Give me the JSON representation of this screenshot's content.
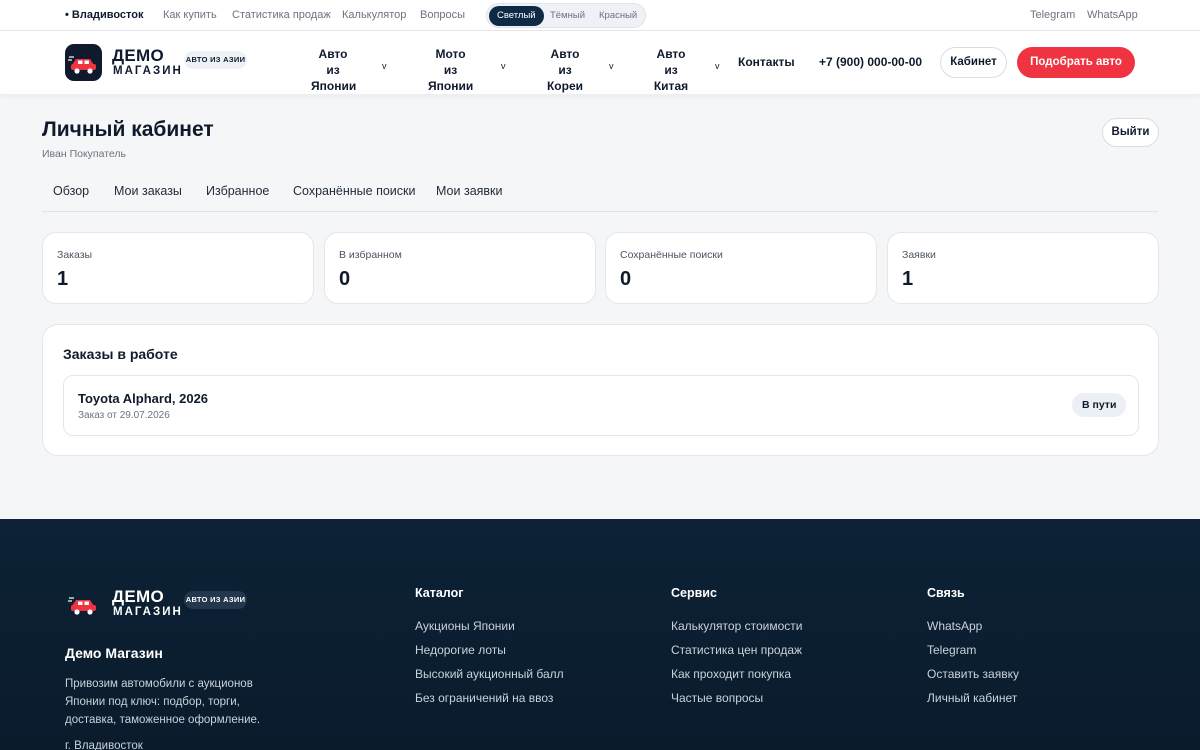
{
  "topbar": {
    "city": "• Владивосток",
    "links": [
      "Как купить",
      "Статистика продаж",
      "Калькулятор",
      "Вопросы"
    ],
    "themes": [
      "Светлый",
      "Тёмный",
      "Красный"
    ],
    "active_theme": "Светлый",
    "socials": [
      "Telegram",
      "WhatsApp"
    ]
  },
  "header": {
    "logo_line1": "ДЕМО",
    "logo_line2": "МАГАЗИН",
    "logo_badge": "АВТО ИЗ АЗИИ",
    "nav": [
      {
        "line1": "Авто из",
        "line2": "Японии"
      },
      {
        "line1": "Мото из",
        "line2": "Японии"
      },
      {
        "line1": "Авто из",
        "line2": "Кореи"
      },
      {
        "line1": "Авто из",
        "line2": "Китая"
      }
    ],
    "nav_chevron": "v",
    "contacts": "Контакты",
    "phone": "+7 (900) 000-00-00",
    "cabinet_button": "Кабинет",
    "pick_button": "Подобрать авто"
  },
  "page": {
    "title": "Личный кабинет",
    "user": "Иван Покупатель",
    "logout_button": "Выйти",
    "tabs": [
      "Обзор",
      "Мои заказы",
      "Избранное",
      "Сохранённые поиски",
      "Мои заявки"
    ]
  },
  "stats": [
    {
      "label": "Заказы",
      "value": "1"
    },
    {
      "label": "В избранном",
      "value": "0"
    },
    {
      "label": "Сохранённые поиски",
      "value": "0"
    },
    {
      "label": "Заявки",
      "value": "1"
    }
  ],
  "orders": {
    "title": "Заказы в работе",
    "items": [
      {
        "name": "Toyota Alphard, 2026",
        "date": "Заказ от 29.07.2026",
        "status": "В пути"
      }
    ]
  },
  "footer": {
    "logo_line1": "ДЕМО",
    "logo_line2": "МАГАЗИН",
    "logo_badge": "АВТО ИЗ АЗИИ",
    "brand": "Демо Магазин",
    "description": "Привозим автомобили с аукционов Японии под ключ: подбор, торги, доставка, таможенное оформление.",
    "city": "г. Владивосток",
    "columns": [
      {
        "title": "Каталог",
        "links": [
          "Аукционы Японии",
          "Недорогие лоты",
          "Высокий аукционный балл",
          "Без ограничений на ввоз"
        ]
      },
      {
        "title": "Сервис",
        "links": [
          "Калькулятор стоимости",
          "Статистика цен продаж",
          "Как проходит покупка",
          "Частые вопросы"
        ]
      },
      {
        "title": "Связь",
        "links": [
          "WhatsApp",
          "Telegram",
          "Оставить заявку",
          "Личный кабинет"
        ]
      }
    ]
  },
  "colors": {
    "accent_red": "#ef3340",
    "navy": "#0f1b2d",
    "footer_bg": "#0d2236"
  }
}
